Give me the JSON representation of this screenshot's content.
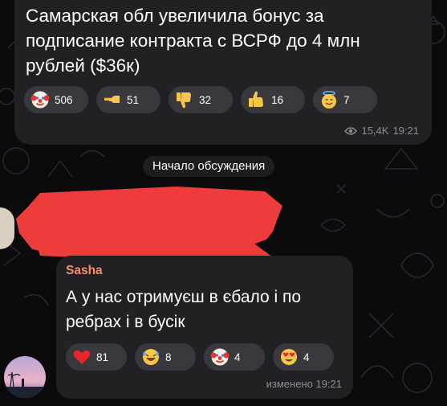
{
  "post": {
    "text": "Самарская обл увеличила бонус за подписание контракта с ВСРФ до 4 млн рублей ($36к)",
    "reactions": [
      {
        "icon": "clown-face-icon",
        "count": "506"
      },
      {
        "icon": "pointing-left-hand-icon",
        "count": "51"
      },
      {
        "icon": "thumbs-down-icon",
        "count": "32"
      },
      {
        "icon": "thumbs-up-icon",
        "count": "16"
      },
      {
        "icon": "smiling-face-with-halo-icon",
        "count": "7"
      }
    ],
    "views": "15,4K",
    "time": "19:21"
  },
  "discussion_label": "Начало обсуждения",
  "reply": {
    "author": "Sasha",
    "text": "А у нас отримуєш в єбало і по ребрах і в бусік",
    "reactions": [
      {
        "icon": "red-heart-icon",
        "count": "81"
      },
      {
        "icon": "rolling-laughing-face-icon",
        "count": "8"
      },
      {
        "icon": "clown-face-icon",
        "count": "4"
      },
      {
        "icon": "heart-eyes-face-icon",
        "count": "4"
      }
    ],
    "edited_time": "изменено 19:21"
  },
  "colors": {
    "bubble": "#212124",
    "chip": "#38383d",
    "author": "#f78e6e",
    "redaction": "#ee3b3b",
    "meta": "#8e8e93"
  }
}
